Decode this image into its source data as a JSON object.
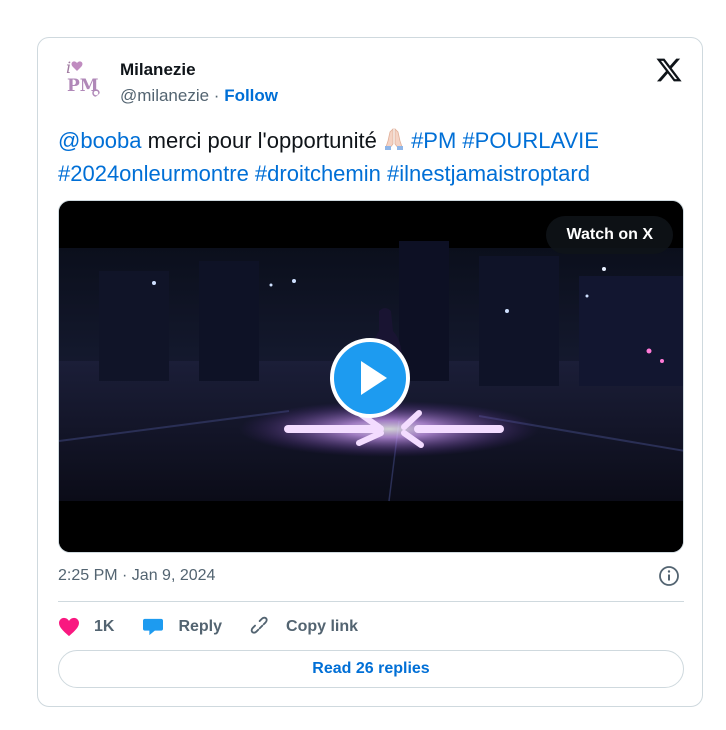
{
  "author": {
    "name": "Milanezie",
    "handle": "@milanezie",
    "separator": " · ",
    "follow_label": "Follow"
  },
  "tweet": {
    "mention": "@booba",
    "text": " merci pour l'opportunité ",
    "emoji": "folded-hands-emoji",
    "hashtags_line1": " #PM #POURLAVIE",
    "hashtags_line2": "#2024onleurmontre #droitchemin #ilnestjamaistroptard"
  },
  "media": {
    "watch_label": "Watch on X"
  },
  "meta": {
    "timestamp": "2:25 PM · Jan 9, 2024"
  },
  "actions": {
    "likes_count": "1K",
    "reply_label": "Reply",
    "copy_link_label": "Copy link"
  },
  "replies_button": {
    "label": "Read 26 replies"
  },
  "colors": {
    "link": "#006fd6",
    "like": "#f91880",
    "reply": "#1d9bf0",
    "text": "#0f1419",
    "muted": "#536471",
    "border": "#cfd9de"
  }
}
